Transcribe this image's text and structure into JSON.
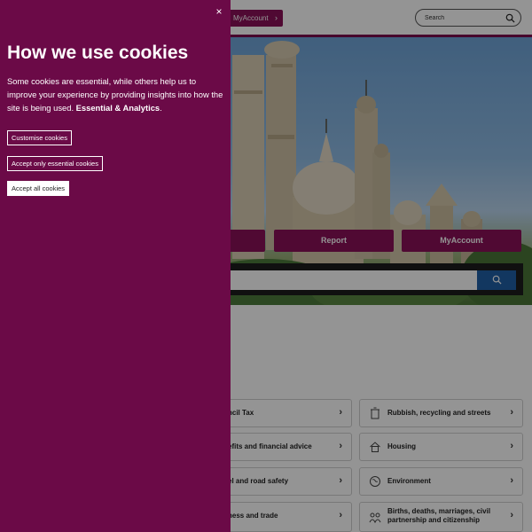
{
  "header": {
    "myaccount_label": "MyAccount",
    "search_placeholder": "Search"
  },
  "quick_links": [
    {
      "label": ""
    },
    {
      "label": "Report"
    },
    {
      "label": "MyAccount"
    }
  ],
  "services": [
    {
      "label": "ncil Tax",
      "icon": ""
    },
    {
      "label": "Rubbish, recycling and streets",
      "icon": "bin-icon"
    },
    {
      "label": "efits and financial advice",
      "icon": ""
    },
    {
      "label": "Housing",
      "icon": "house-icon"
    },
    {
      "label": "el and road safety",
      "icon": ""
    },
    {
      "label": "Environment",
      "icon": "globe-icon"
    },
    {
      "label": "ness and trade",
      "icon": ""
    },
    {
      "label": "Births, deaths, marriages, civil partnership and citizenship",
      "icon": "people-icon"
    }
  ],
  "cookie_banner": {
    "close_glyph": "×",
    "title": "How we use cookies",
    "body": "Some cookies are essential, while others help us to improve your experience by providing insights into how the site is being used.",
    "body_bold": "Essential & Analytics",
    "body_end": ".",
    "customise_label": "Customise cookies",
    "essential_only_label": "Accept only essential cookies",
    "accept_all_label": "Accept all cookies"
  },
  "colors": {
    "panel": "#6b0a47",
    "brand": "#8a1158",
    "search_button": "#1f5fa6"
  }
}
